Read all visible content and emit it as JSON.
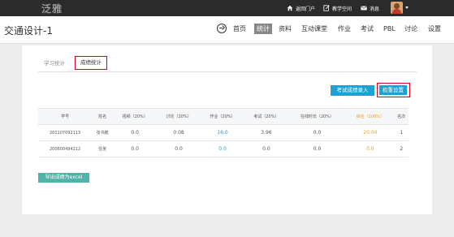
{
  "topbar": {
    "logo": "泛雅",
    "links": [
      {
        "label": "返回门户",
        "icon": "home-icon"
      },
      {
        "label": "教学空间",
        "icon": "edit-icon"
      },
      {
        "label": "消息",
        "icon": "mail-icon"
      }
    ]
  },
  "course": {
    "title": "交通设计-1",
    "nav": [
      "首页",
      "统计",
      "资料",
      "互动课堂",
      "作业",
      "考试",
      "PBL",
      "讨论",
      "设置"
    ],
    "active_nav": "统计"
  },
  "tabs": {
    "learning": "学习统计",
    "grades": "成绩统计"
  },
  "actions": {
    "import_label": "考试成绩录入",
    "weight_label": "权重设置",
    "export_label": "导出成绩为excel"
  },
  "table": {
    "headers": [
      "学号",
      "姓名",
      "视频（20%）",
      "讨论（20%）",
      "作业（20%）",
      "考试（20%）",
      "在线时长（20%）",
      "综合（100%）",
      "名次"
    ],
    "rows": [
      [
        "201107092113",
        "张书鹏",
        "0.0",
        "0.08",
        "16.0",
        "3.96",
        "0.0",
        "20.04",
        "1"
      ],
      [
        "200600494212",
        "任芜",
        "0.0",
        "0.0",
        "0.0",
        "0.0",
        "0.0",
        "0.0",
        "2"
      ]
    ]
  },
  "colors": {
    "accent_blue": "#1fa1d3",
    "highlight_orange": "#f39c12",
    "annotation_red": "#d0021b",
    "export_teal": "#4fb3a9"
  }
}
